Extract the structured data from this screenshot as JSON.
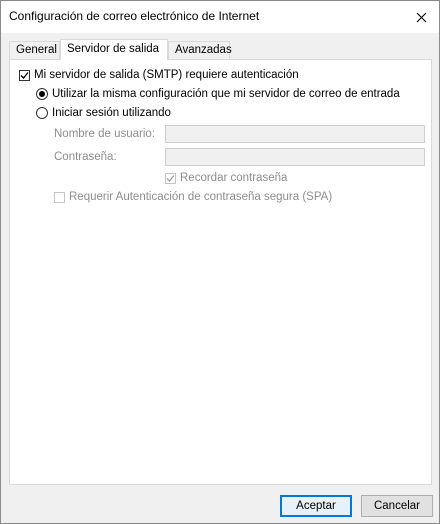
{
  "window": {
    "title": "Configuración de correo electrónico de Internet"
  },
  "tabs": [
    {
      "label": "General"
    },
    {
      "label": "Servidor de salida"
    },
    {
      "label": "Avanzadas"
    }
  ],
  "outgoing": {
    "smtp_auth_label": "Mi servidor de salida (SMTP) requiere autenticación",
    "smtp_auth_checked": true,
    "same_settings_label": "Utilizar la misma configuración que mi servidor de correo de entrada",
    "same_settings_selected": true,
    "login_using_label": "Iniciar sesión utilizando",
    "login_using_selected": false,
    "username_label": "Nombre de usuario:",
    "username_value": "",
    "password_label": "Contraseña:",
    "password_value": "",
    "remember_password_label": "Recordar contraseña",
    "remember_password_checked": true,
    "spa_label": "Requerir Autenticación de contraseña segura (SPA)",
    "spa_checked": false
  },
  "buttons": {
    "accept": "Aceptar",
    "cancel": "Cancelar"
  },
  "colors": {
    "accent": "#0078d7",
    "disabled_text": "#8d8d8d"
  }
}
